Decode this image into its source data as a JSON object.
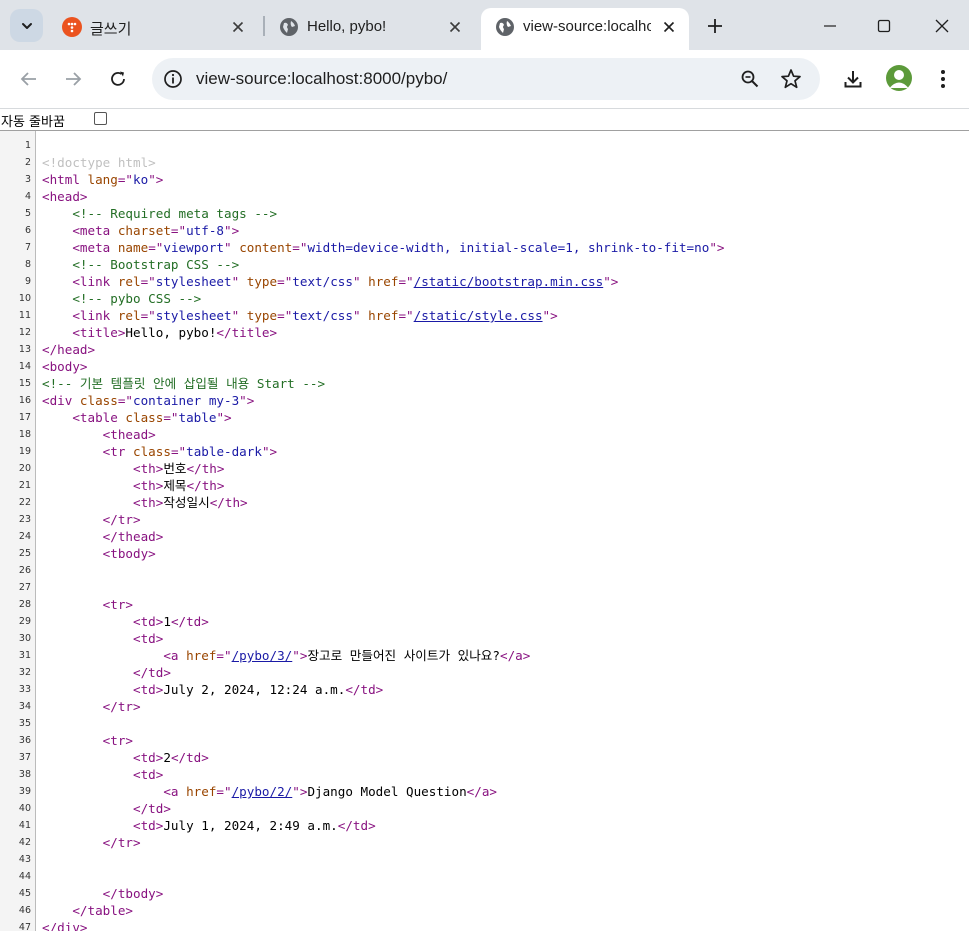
{
  "tabs": [
    {
      "title": "글쓰기",
      "favicon": "tistory-icon",
      "active": false
    },
    {
      "title": "Hello, pybo!",
      "favicon": "globe-icon",
      "active": false
    },
    {
      "title": "view-source:localhost",
      "favicon": "globe-icon",
      "active": true
    }
  ],
  "address_bar": {
    "url": "view-source:localhost:8000/pybo/"
  },
  "wrap_toggle": {
    "label": "자동 줄바꿈",
    "checked": false
  },
  "colors": {
    "tag": "#881280",
    "attr": "#994500",
    "value": "#1a1aa6",
    "comment": "#236e25",
    "doctype": "#c0c0c0"
  },
  "source": {
    "lines": [
      {
        "n": "1",
        "s": []
      },
      {
        "n": "2",
        "s": [
          {
            "k": "d",
            "t": "<!doctype html>"
          }
        ]
      },
      {
        "n": "3",
        "s": [
          {
            "k": "t",
            "t": "<html "
          },
          {
            "k": "a",
            "t": "lang"
          },
          {
            "k": "t",
            "t": "=\""
          },
          {
            "k": "v",
            "t": "ko"
          },
          {
            "k": "t",
            "t": "\">"
          }
        ]
      },
      {
        "n": "4",
        "s": [
          {
            "k": "t",
            "t": "<head>"
          }
        ]
      },
      {
        "n": "5",
        "s": [
          {
            "k": "p",
            "t": "    "
          },
          {
            "k": "c",
            "t": "<!-- Required meta tags -->"
          }
        ]
      },
      {
        "n": "6",
        "s": [
          {
            "k": "p",
            "t": "    "
          },
          {
            "k": "t",
            "t": "<meta "
          },
          {
            "k": "a",
            "t": "charset"
          },
          {
            "k": "t",
            "t": "=\""
          },
          {
            "k": "v",
            "t": "utf-8"
          },
          {
            "k": "t",
            "t": "\">"
          }
        ]
      },
      {
        "n": "7",
        "s": [
          {
            "k": "p",
            "t": "    "
          },
          {
            "k": "t",
            "t": "<meta "
          },
          {
            "k": "a",
            "t": "name"
          },
          {
            "k": "t",
            "t": "=\""
          },
          {
            "k": "v",
            "t": "viewport"
          },
          {
            "k": "t",
            "t": "\" "
          },
          {
            "k": "a",
            "t": "content"
          },
          {
            "k": "t",
            "t": "=\""
          },
          {
            "k": "v",
            "t": "width=device-width, initial-scale=1, shrink-to-fit=no"
          },
          {
            "k": "t",
            "t": "\">"
          }
        ]
      },
      {
        "n": "8",
        "s": [
          {
            "k": "p",
            "t": "    "
          },
          {
            "k": "c",
            "t": "<!-- Bootstrap CSS -->"
          }
        ]
      },
      {
        "n": "9",
        "s": [
          {
            "k": "p",
            "t": "    "
          },
          {
            "k": "t",
            "t": "<link "
          },
          {
            "k": "a",
            "t": "rel"
          },
          {
            "k": "t",
            "t": "=\""
          },
          {
            "k": "v",
            "t": "stylesheet"
          },
          {
            "k": "t",
            "t": "\" "
          },
          {
            "k": "a",
            "t": "type"
          },
          {
            "k": "t",
            "t": "=\""
          },
          {
            "k": "v",
            "t": "text/css"
          },
          {
            "k": "t",
            "t": "\" "
          },
          {
            "k": "a",
            "t": "href"
          },
          {
            "k": "t",
            "t": "=\""
          },
          {
            "k": "l",
            "t": "/static/bootstrap.min.css"
          },
          {
            "k": "t",
            "t": "\">"
          }
        ]
      },
      {
        "n": "10",
        "s": [
          {
            "k": "p",
            "t": "    "
          },
          {
            "k": "c",
            "t": "<!-- pybo CSS -->"
          }
        ]
      },
      {
        "n": "11",
        "s": [
          {
            "k": "p",
            "t": "    "
          },
          {
            "k": "t",
            "t": "<link "
          },
          {
            "k": "a",
            "t": "rel"
          },
          {
            "k": "t",
            "t": "=\""
          },
          {
            "k": "v",
            "t": "stylesheet"
          },
          {
            "k": "t",
            "t": "\" "
          },
          {
            "k": "a",
            "t": "type"
          },
          {
            "k": "t",
            "t": "=\""
          },
          {
            "k": "v",
            "t": "text/css"
          },
          {
            "k": "t",
            "t": "\" "
          },
          {
            "k": "a",
            "t": "href"
          },
          {
            "k": "t",
            "t": "=\""
          },
          {
            "k": "l",
            "t": "/static/style.css"
          },
          {
            "k": "t",
            "t": "\">"
          }
        ]
      },
      {
        "n": "12",
        "s": [
          {
            "k": "p",
            "t": "    "
          },
          {
            "k": "t",
            "t": "<title>"
          },
          {
            "k": "p",
            "t": "Hello, pybo!"
          },
          {
            "k": "t",
            "t": "</title>"
          }
        ]
      },
      {
        "n": "13",
        "s": [
          {
            "k": "t",
            "t": "</head>"
          }
        ]
      },
      {
        "n": "14",
        "s": [
          {
            "k": "t",
            "t": "<body>"
          }
        ]
      },
      {
        "n": "15",
        "s": [
          {
            "k": "c",
            "t": "<!-- 기본 템플릿 안에 삽입될 내용 Start -->"
          }
        ]
      },
      {
        "n": "16",
        "s": [
          {
            "k": "t",
            "t": "<div "
          },
          {
            "k": "a",
            "t": "class"
          },
          {
            "k": "t",
            "t": "=\""
          },
          {
            "k": "v",
            "t": "container my-3"
          },
          {
            "k": "t",
            "t": "\">"
          }
        ]
      },
      {
        "n": "17",
        "s": [
          {
            "k": "p",
            "t": "    "
          },
          {
            "k": "t",
            "t": "<table "
          },
          {
            "k": "a",
            "t": "class"
          },
          {
            "k": "t",
            "t": "=\""
          },
          {
            "k": "v",
            "t": "table"
          },
          {
            "k": "t",
            "t": "\">"
          }
        ]
      },
      {
        "n": "18",
        "s": [
          {
            "k": "p",
            "t": "        "
          },
          {
            "k": "t",
            "t": "<thead>"
          }
        ]
      },
      {
        "n": "19",
        "s": [
          {
            "k": "p",
            "t": "        "
          },
          {
            "k": "t",
            "t": "<tr "
          },
          {
            "k": "a",
            "t": "class"
          },
          {
            "k": "t",
            "t": "=\""
          },
          {
            "k": "v",
            "t": "table-dark"
          },
          {
            "k": "t",
            "t": "\">"
          }
        ]
      },
      {
        "n": "20",
        "s": [
          {
            "k": "p",
            "t": "            "
          },
          {
            "k": "t",
            "t": "<th>"
          },
          {
            "k": "p",
            "t": "번호"
          },
          {
            "k": "t",
            "t": "</th>"
          }
        ]
      },
      {
        "n": "21",
        "s": [
          {
            "k": "p",
            "t": "            "
          },
          {
            "k": "t",
            "t": "<th>"
          },
          {
            "k": "p",
            "t": "제목"
          },
          {
            "k": "t",
            "t": "</th>"
          }
        ]
      },
      {
        "n": "22",
        "s": [
          {
            "k": "p",
            "t": "            "
          },
          {
            "k": "t",
            "t": "<th>"
          },
          {
            "k": "p",
            "t": "작성일시"
          },
          {
            "k": "t",
            "t": "</th>"
          }
        ]
      },
      {
        "n": "23",
        "s": [
          {
            "k": "p",
            "t": "        "
          },
          {
            "k": "t",
            "t": "</tr>"
          }
        ]
      },
      {
        "n": "24",
        "s": [
          {
            "k": "p",
            "t": "        "
          },
          {
            "k": "t",
            "t": "</thead>"
          }
        ]
      },
      {
        "n": "25",
        "s": [
          {
            "k": "p",
            "t": "        "
          },
          {
            "k": "t",
            "t": "<tbody>"
          }
        ]
      },
      {
        "n": "26",
        "s": []
      },
      {
        "n": "27",
        "s": []
      },
      {
        "n": "28",
        "s": [
          {
            "k": "p",
            "t": "        "
          },
          {
            "k": "t",
            "t": "<tr>"
          }
        ]
      },
      {
        "n": "29",
        "s": [
          {
            "k": "p",
            "t": "            "
          },
          {
            "k": "t",
            "t": "<td>"
          },
          {
            "k": "p",
            "t": "1"
          },
          {
            "k": "t",
            "t": "</td>"
          }
        ]
      },
      {
        "n": "30",
        "s": [
          {
            "k": "p",
            "t": "            "
          },
          {
            "k": "t",
            "t": "<td>"
          }
        ]
      },
      {
        "n": "31",
        "s": [
          {
            "k": "p",
            "t": "                "
          },
          {
            "k": "t",
            "t": "<a "
          },
          {
            "k": "a",
            "t": "href"
          },
          {
            "k": "t",
            "t": "=\""
          },
          {
            "k": "l",
            "t": "/pybo/3/"
          },
          {
            "k": "t",
            "t": "\">"
          },
          {
            "k": "p",
            "t": "장고로 만들어진 사이트가 있나요?"
          },
          {
            "k": "t",
            "t": "</a>"
          }
        ]
      },
      {
        "n": "32",
        "s": [
          {
            "k": "p",
            "t": "            "
          },
          {
            "k": "t",
            "t": "</td>"
          }
        ]
      },
      {
        "n": "33",
        "s": [
          {
            "k": "p",
            "t": "            "
          },
          {
            "k": "t",
            "t": "<td>"
          },
          {
            "k": "p",
            "t": "July 2, 2024, 12:24 a.m."
          },
          {
            "k": "t",
            "t": "</td>"
          }
        ]
      },
      {
        "n": "34",
        "s": [
          {
            "k": "p",
            "t": "        "
          },
          {
            "k": "t",
            "t": "</tr>"
          }
        ]
      },
      {
        "n": "35",
        "s": []
      },
      {
        "n": "36",
        "s": [
          {
            "k": "p",
            "t": "        "
          },
          {
            "k": "t",
            "t": "<tr>"
          }
        ]
      },
      {
        "n": "37",
        "s": [
          {
            "k": "p",
            "t": "            "
          },
          {
            "k": "t",
            "t": "<td>"
          },
          {
            "k": "p",
            "t": "2"
          },
          {
            "k": "t",
            "t": "</td>"
          }
        ]
      },
      {
        "n": "38",
        "s": [
          {
            "k": "p",
            "t": "            "
          },
          {
            "k": "t",
            "t": "<td>"
          }
        ]
      },
      {
        "n": "39",
        "s": [
          {
            "k": "p",
            "t": "                "
          },
          {
            "k": "t",
            "t": "<a "
          },
          {
            "k": "a",
            "t": "href"
          },
          {
            "k": "t",
            "t": "=\""
          },
          {
            "k": "l",
            "t": "/pybo/2/"
          },
          {
            "k": "t",
            "t": "\">"
          },
          {
            "k": "p",
            "t": "Django Model Question"
          },
          {
            "k": "t",
            "t": "</a>"
          }
        ]
      },
      {
        "n": "40",
        "s": [
          {
            "k": "p",
            "t": "            "
          },
          {
            "k": "t",
            "t": "</td>"
          }
        ]
      },
      {
        "n": "41",
        "s": [
          {
            "k": "p",
            "t": "            "
          },
          {
            "k": "t",
            "t": "<td>"
          },
          {
            "k": "p",
            "t": "July 1, 2024, 2:49 a.m."
          },
          {
            "k": "t",
            "t": "</td>"
          }
        ]
      },
      {
        "n": "42",
        "s": [
          {
            "k": "p",
            "t": "        "
          },
          {
            "k": "t",
            "t": "</tr>"
          }
        ]
      },
      {
        "n": "43",
        "s": []
      },
      {
        "n": "44",
        "s": []
      },
      {
        "n": "45",
        "s": [
          {
            "k": "p",
            "t": "        "
          },
          {
            "k": "t",
            "t": "</tbody>"
          }
        ]
      },
      {
        "n": "46",
        "s": [
          {
            "k": "p",
            "t": "    "
          },
          {
            "k": "t",
            "t": "</table>"
          }
        ]
      },
      {
        "n": "47",
        "s": [
          {
            "k": "t",
            "t": "</div>"
          }
        ]
      }
    ]
  }
}
